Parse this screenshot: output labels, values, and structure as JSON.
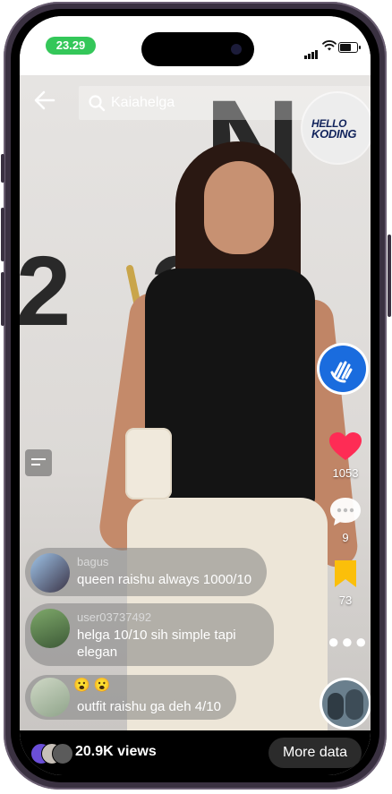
{
  "status_bar": {
    "time": "23.29"
  },
  "search": {
    "query": "Kaiahelga"
  },
  "logo": {
    "line1": "HELLO",
    "line2": "KODING"
  },
  "background": {
    "glyph_a": "N",
    "glyph_b": "23"
  },
  "rail": {
    "likes": "1053",
    "comments": "9",
    "saves": "73"
  },
  "comments": [
    {
      "user": "bagus",
      "text": "queen raishu always 1000/10"
    },
    {
      "user": "user03737492",
      "text_line1": "helga 10/10 sih simple tapi",
      "text_line2": "elegan"
    },
    {
      "user": "",
      "text": "outfit raishu ga deh 4/10"
    }
  ],
  "footer": {
    "views": "20.9K views",
    "more_button": "More data"
  },
  "colors": {
    "status_green": "#34c759",
    "like_red": "#fe2c55",
    "save_yellow": "#fbbf0a",
    "wave_blue": "#1a6cde"
  },
  "icons": [
    "back-arrow-icon",
    "search-icon",
    "caption-icon",
    "wave-hand-icon",
    "heart-icon",
    "comment-icon",
    "bookmark-icon",
    "more-icon"
  ]
}
